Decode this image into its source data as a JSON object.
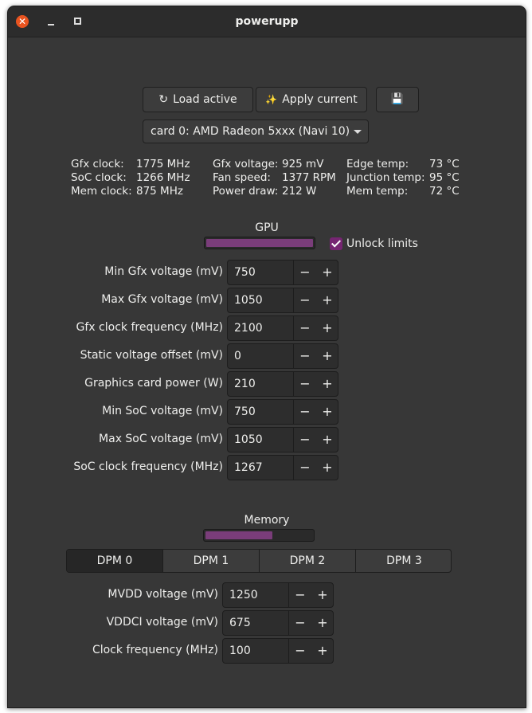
{
  "window": {
    "title": "powerupp",
    "close_glyph": "✕"
  },
  "toolbar": {
    "load_label": "Load active",
    "load_icon": "↻",
    "apply_label": "Apply current",
    "apply_icon": "✨",
    "save_icon": "💾"
  },
  "card_select": {
    "selected": "card 0: AMD Radeon 5xxx (Navi 10)"
  },
  "stats": {
    "col1": [
      {
        "label": "Gfx clock:",
        "value": "1775 MHz"
      },
      {
        "label": "SoC clock:",
        "value": "1266 MHz"
      },
      {
        "label": "Mem clock:",
        "value": "875 MHz"
      }
    ],
    "col2": [
      {
        "label": "Gfx voltage:",
        "value": "925 mV"
      },
      {
        "label": "Fan speed:",
        "value": "1377 RPM"
      },
      {
        "label": "Power draw:",
        "value": "212 W"
      }
    ],
    "col3": [
      {
        "label": "Edge temp:",
        "value": "73 °C"
      },
      {
        "label": "Junction temp:",
        "value": "95 °C"
      },
      {
        "label": "Mem temp:",
        "value": "72 °C"
      }
    ]
  },
  "gpu": {
    "label": "GPU",
    "usage_fraction": 1.0,
    "unlock_label": "Unlock limits",
    "unlock_checked": true,
    "rows": [
      {
        "label": "Min Gfx voltage (mV)",
        "value": "750"
      },
      {
        "label": "Max Gfx voltage (mV)",
        "value": "1050"
      },
      {
        "label": "Gfx clock frequency (MHz)",
        "value": "2100"
      },
      {
        "label": "Static voltage offset (mV)",
        "value": "0"
      },
      {
        "label": "Graphics card power (W)",
        "value": "210"
      },
      {
        "label": "Min SoC voltage (mV)",
        "value": "750"
      },
      {
        "label": "Max SoC voltage (mV)",
        "value": "1050"
      },
      {
        "label": "SoC clock frequency (MHz)",
        "value": "1267"
      }
    ]
  },
  "memory": {
    "label": "Memory",
    "usage_fraction": 0.63,
    "tabs": [
      "DPM 0",
      "DPM 1",
      "DPM 2",
      "DPM 3"
    ],
    "active_tab": "DPM 0",
    "rows": [
      {
        "label": "MVDD voltage (mV)",
        "value": "1250"
      },
      {
        "label": "VDDCI voltage (mV)",
        "value": "675"
      },
      {
        "label": "Clock frequency (MHz)",
        "value": "100"
      }
    ]
  },
  "spin": {
    "minus": "−",
    "plus": "+"
  },
  "colors": {
    "accent": "#762572",
    "bar_fill": "#7a3d7a",
    "close": "#e95420"
  }
}
